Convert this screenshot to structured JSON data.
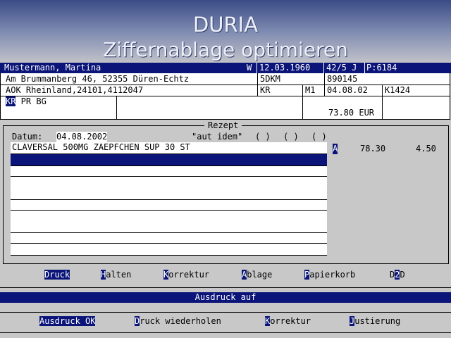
{
  "app": {
    "title": "DURIA",
    "subtitle": "Ziffernablage optimieren"
  },
  "patient": {
    "name": "Mustermann, Martina",
    "gender": "W",
    "birthdate": "12.03.1960",
    "age": "42/5 J",
    "patient_id": "P:6184",
    "address": "Am Brummanberg 46, 52355 Düren-Echtz",
    "status": "5DKM",
    "insurance_no": "890145",
    "insurer": "AOK Rheinland,24101,4112047",
    "ins_type": "KR",
    "member_type": "M1",
    "valid_date": "04.08.02",
    "doc_code": "K1424",
    "flags_kr": "KR",
    "flags_rest": " PR BG",
    "amount": "73.80 EUR"
  },
  "rezept": {
    "section_title": "Rezept",
    "date_label": "Datum:",
    "date_value": "04.08.2002",
    "aut_idem_label": "\"aut idem\"",
    "checkbox_1": "( )",
    "checkbox_2": "( )",
    "checkbox_3": "( )",
    "items": [
      {
        "text": "CLAVERSAL 500MG ZAEPFCHEN SUP 30 ST",
        "flag": "A",
        "price": "78.30",
        "copay": "4.50"
      }
    ]
  },
  "menu": {
    "druck": {
      "hot": "D",
      "rest": "ruck"
    },
    "halten": {
      "hot": "H",
      "rest": "alten"
    },
    "korrektur": {
      "hot": "K",
      "rest": "orrektur"
    },
    "ablage": {
      "hot": "A",
      "rest": "blage"
    },
    "papierkorb": {
      "hot": "P",
      "rest": "apierkorb"
    },
    "d2d": {
      "pre": "D",
      "hot": "2",
      "post": "D"
    }
  },
  "status": {
    "text": "Ausdruck auf"
  },
  "actions": {
    "ausdruck_ok": "Ausdruck OK",
    "druck_wiederholen": {
      "hot": "D",
      "rest": "ruck wiederholen"
    },
    "korrektur": {
      "hot": "K",
      "rest": "orrektur"
    },
    "justierung": {
      "hot": "J",
      "rest": "ustierung"
    }
  },
  "colors": {
    "navy": "#0b1478",
    "background": "#c8c8c8",
    "header_top": "#3a4c86"
  }
}
